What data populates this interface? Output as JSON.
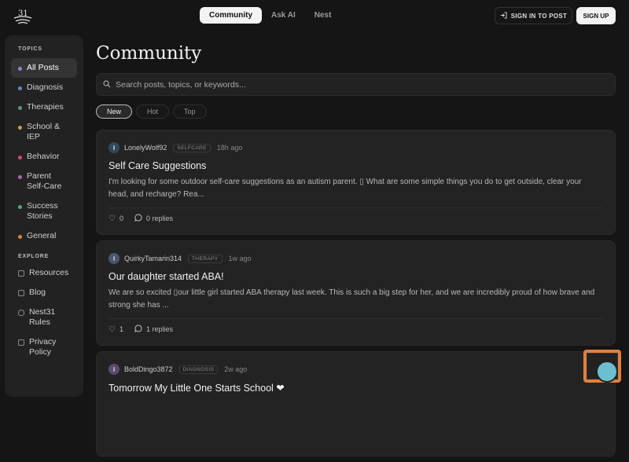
{
  "brand": {
    "logo_text": "31"
  },
  "topnav": {
    "tabs": [
      {
        "label": "Community"
      },
      {
        "label": "Ask AI"
      },
      {
        "label": "Nest"
      }
    ],
    "signin_label": "SIGN IN TO POST",
    "signup_label": "SIGN UP"
  },
  "sidebar": {
    "topics_title": "TOPICS",
    "topics": [
      {
        "label": "All Posts",
        "color": "#8f86d6"
      },
      {
        "label": "Diagnosis",
        "color": "#6f80c9"
      },
      {
        "label": "Therapies",
        "color": "#4f9f7a"
      },
      {
        "label": "School & IEP",
        "color": "#c7a33f"
      },
      {
        "label": "Behavior",
        "color": "#c7506a"
      },
      {
        "label": "Parent Self-Care",
        "color": "#b05fb0"
      },
      {
        "label": "Success Stories",
        "color": "#4fb06a"
      },
      {
        "label": "General",
        "color": "#d08a3c"
      }
    ],
    "explore_title": "EXPLORE",
    "explore": [
      {
        "label": "Resources"
      },
      {
        "label": "Blog"
      },
      {
        "label": "Nest31 Rules"
      },
      {
        "label": "Privacy Policy"
      }
    ]
  },
  "main": {
    "title": "Community",
    "search_placeholder": "Search posts, topics, or keywords...",
    "filters": [
      {
        "label": "New"
      },
      {
        "label": "Hot"
      },
      {
        "label": "Top"
      }
    ],
    "posts": [
      {
        "author": "LonelyWolf92",
        "tag": "SELFCARE",
        "time": "18h ago",
        "avatar_color": "#2f4a5c",
        "title": "Self Care Suggestions",
        "body": "I'm looking for some outdoor self-care suggestions as an autism parent. ▯ What are some simple things you do to get outside, clear your head, and recharge? Rea...",
        "likes": "0",
        "replies": "0 replies"
      },
      {
        "author": "QuirkyTamarin314",
        "tag": "THERAPY",
        "time": "1w ago",
        "avatar_color": "#4a5670",
        "title": "Our daughter started ABA!",
        "body": "We are so excited ▯our little girl started ABA therapy last week. This is such a big step for her, and we are incredibly proud of how brave and strong she has ...",
        "likes": "1",
        "replies": "1 replies"
      },
      {
        "author": "BoldDingo3872",
        "tag": "DIAGNOSIS",
        "time": "2w ago",
        "avatar_color": "#5c4a70",
        "title": "Tomorrow My Little One Starts School ❤",
        "body": "",
        "likes": "",
        "replies": ""
      }
    ]
  }
}
